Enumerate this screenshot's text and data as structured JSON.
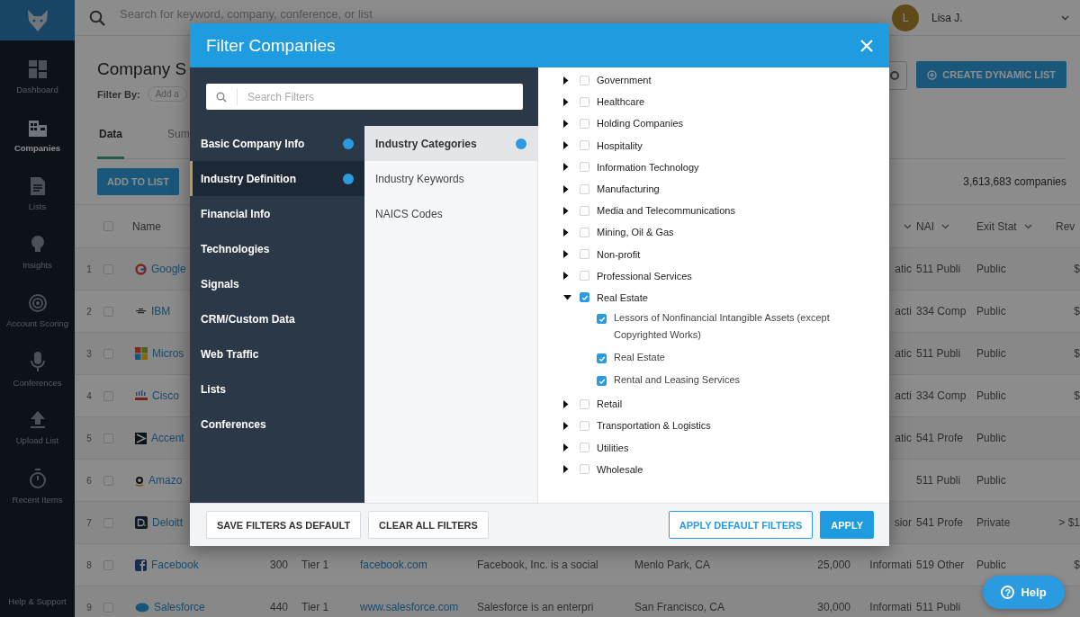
{
  "nav": {
    "items": [
      {
        "label": "Dashboard",
        "selected": false
      },
      {
        "label": "Companies",
        "selected": true
      },
      {
        "label": "Lists",
        "selected": false
      },
      {
        "label": "Insights",
        "selected": false
      },
      {
        "label": "Account Scoring",
        "selected": false
      },
      {
        "label": "Conferences",
        "selected": false
      },
      {
        "label": "Upload List",
        "selected": false
      },
      {
        "label": "Recent Items",
        "selected": false
      }
    ],
    "footer": "Help & Support"
  },
  "topbar": {
    "search_placeholder": "Search for keyword, company, conference, or list",
    "user": {
      "initial": "L",
      "name": "Lisa J."
    }
  },
  "page": {
    "title": "Company S",
    "filter_label": "Filter By:",
    "filter_placeholder": "Add a",
    "tabs": [
      {
        "label": "Data",
        "selected": true
      },
      {
        "label": "Sum",
        "selected": false
      }
    ],
    "add_button": "ADD TO LIST",
    "create_button": "CREATE DYNAMIC LIST",
    "count": "3,613,683 companies"
  },
  "table": {
    "select_all_checked": false,
    "columns": [
      {
        "label": "Name",
        "menu": false
      },
      {
        "menu": true
      },
      {
        "label": "NAI",
        "menu": true
      },
      {
        "label": "Exit Stat",
        "menu": true
      },
      {
        "label": "Rev",
        "menu": false
      }
    ],
    "rows": [
      {
        "number": "1",
        "checked": false,
        "name": "Google",
        "industry": "atic",
        "naics": "511 Publi",
        "exit_status": "Public",
        "revenue": "$"
      },
      {
        "number": "2",
        "checked": false,
        "name": "IBM",
        "industry": "acti",
        "naics": "334 Comp",
        "exit_status": "Public",
        "revenue": "$"
      },
      {
        "number": "3",
        "checked": false,
        "name": "Micros",
        "industry": "atic",
        "naics": "511 Publi",
        "exit_status": "Public",
        "revenue": "$"
      },
      {
        "number": "4",
        "checked": false,
        "name": "Cisco",
        "industry": "acti",
        "naics": "334 Comp",
        "exit_status": "Public",
        "revenue": "$"
      },
      {
        "number": "5",
        "checked": false,
        "name": "Accent",
        "industry": "atic",
        "naics": "541 Profe",
        "exit_status": "Public"
      },
      {
        "number": "6",
        "checked": false,
        "name": "Amazo",
        "naics": "511 Publi",
        "exit_status": "Public"
      },
      {
        "number": "7",
        "checked": false,
        "name": "Deloitt",
        "industry": "sior",
        "naics": "541 Profe",
        "exit_status": "Private",
        "revenue": "> $1"
      },
      {
        "number": "8",
        "checked": false,
        "name": "Facebook",
        "employees": "300",
        "tier": "Tier 1",
        "website": "facebook.com",
        "description": "Facebook, Inc. is a social",
        "location": "Menlo Park, CA",
        "headcount": "25,000",
        "industry": "Informati",
        "naics": "519 Other",
        "exit_status": "Public",
        "revenue": "$"
      },
      {
        "number": "9",
        "checked": false,
        "name": "Salesforce",
        "employees": "440",
        "tier": "Tier 1",
        "website": "www.salesforce.com",
        "description": "Salesforce is an enterpri",
        "location": "San Francisco, CA",
        "headcount": "30,000",
        "industry": "Informati",
        "naics": "511 Publi"
      }
    ]
  },
  "modal": {
    "title": "Filter Companies",
    "search_placeholder": "Search Filters",
    "categories": [
      {
        "label": "Basic Company Info",
        "selected": false,
        "has_filters": true
      },
      {
        "label": "Industry Definition",
        "selected": true,
        "has_filters": true
      },
      {
        "label": "Financial Info",
        "selected": false,
        "has_filters": false
      },
      {
        "label": "Technologies",
        "selected": false,
        "has_filters": false
      },
      {
        "label": "Signals",
        "selected": false,
        "has_filters": false
      },
      {
        "label": "CRM/Custom Data",
        "selected": false,
        "has_filters": false
      },
      {
        "label": "Web Traffic",
        "selected": false,
        "has_filters": false
      },
      {
        "label": "Lists",
        "selected": false,
        "has_filters": false
      },
      {
        "label": "Conferences",
        "selected": false,
        "has_filters": false
      }
    ],
    "subcategories": [
      {
        "label": "Industry Categories",
        "selected": true,
        "has_filters": true
      },
      {
        "label": "Industry Keywords",
        "selected": false,
        "has_filters": false
      },
      {
        "label": "NAICS Codes",
        "selected": false,
        "has_filters": false
      }
    ],
    "industries": [
      {
        "label": "Government",
        "expanded": false,
        "checked": false
      },
      {
        "label": "Healthcare",
        "expanded": false,
        "checked": false
      },
      {
        "label": "Holding Companies",
        "expanded": false,
        "checked": false
      },
      {
        "label": "Hospitality",
        "expanded": false,
        "checked": false
      },
      {
        "label": "Information Technology",
        "expanded": false,
        "checked": false
      },
      {
        "label": "Manufacturing",
        "expanded": false,
        "checked": false
      },
      {
        "label": "Media and Telecommunications",
        "expanded": false,
        "checked": false
      },
      {
        "label": "Mining, Oil & Gas",
        "expanded": false,
        "checked": false
      },
      {
        "label": "Non-profit",
        "expanded": false,
        "checked": false
      },
      {
        "label": "Professional Services",
        "expanded": false,
        "checked": false
      },
      {
        "label": "Real Estate",
        "expanded": true,
        "checked": true,
        "children": [
          {
            "label": "Lessors of Nonfinancial Intangible Assets (except Copyrighted Works)",
            "checked": true
          },
          {
            "label": "Real Estate",
            "checked": true
          },
          {
            "label": "Rental and Leasing Services",
            "checked": true
          }
        ]
      },
      {
        "label": "Retail",
        "expanded": false,
        "checked": false
      },
      {
        "label": "Transportation & Logistics",
        "expanded": false,
        "checked": false
      },
      {
        "label": "Utilities",
        "expanded": false,
        "checked": false
      },
      {
        "label": "Wholesale",
        "expanded": false,
        "checked": false
      }
    ],
    "footer_buttons": [
      {
        "label": "SAVE FILTERS AS DEFAULT",
        "kind": "secondary"
      },
      {
        "label": "CLEAR ALL FILTERS",
        "kind": "secondary"
      },
      {
        "label": "APPLY DEFAULT FILTERS",
        "kind": "outline"
      },
      {
        "label": "APPLY",
        "kind": "primary"
      }
    ]
  },
  "help_button": {
    "icon": "?",
    "label": "Help"
  }
}
